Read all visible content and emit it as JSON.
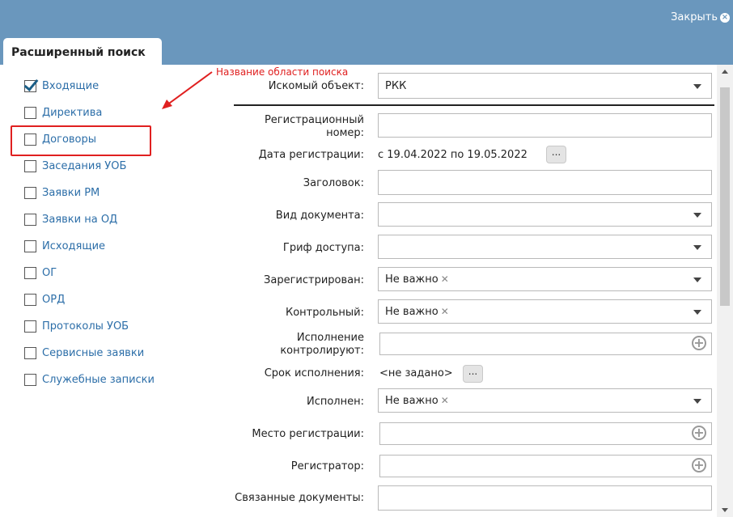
{
  "header": {
    "close_label": "Закрыть"
  },
  "tab": {
    "title": "Расширенный поиск"
  },
  "annotation": {
    "text": "Название области поиска"
  },
  "sidebar": {
    "items": [
      {
        "label": "Входящие"
      },
      {
        "label": "Директива"
      },
      {
        "label": "Договоры"
      },
      {
        "label": "Заседания УОБ"
      },
      {
        "label": "Заявки РМ"
      },
      {
        "label": "Заявки на ОД"
      },
      {
        "label": "Исходящие"
      },
      {
        "label": "ОГ"
      },
      {
        "label": "ОРД"
      },
      {
        "label": "Протоколы УОБ"
      },
      {
        "label": "Сервисные заявки"
      },
      {
        "label": "Служебные записки"
      }
    ],
    "checked": [
      "Входящие"
    ]
  },
  "form": {
    "search_object": {
      "label": "Искомый объект:",
      "value": "РКК"
    },
    "reg_number": {
      "label_line1": "Регистрационный",
      "label_line2": "номер:",
      "value": ""
    },
    "reg_date": {
      "label": "Дата регистрации:",
      "value": "с 19.04.2022 по 19.05.2022",
      "button": "..."
    },
    "heading": {
      "label": "Заголовок:",
      "value": ""
    },
    "doc_type": {
      "label": "Вид документа:",
      "value": ""
    },
    "access": {
      "label": "Гриф доступа:",
      "value": ""
    },
    "registered": {
      "label": "Зарегистрирован:",
      "value": "Не важно",
      "clear": "✕"
    },
    "control": {
      "label": "Контрольный:",
      "value": "Не важно",
      "clear": "✕"
    },
    "controllers": {
      "label_line1": "Исполнение",
      "label_line2": "контролируют:",
      "value": ""
    },
    "deadline": {
      "label": "Срок исполнения:",
      "value": "<не задано>",
      "button": "..."
    },
    "executed": {
      "label": "Исполнен:",
      "value": "Не важно",
      "clear": "✕"
    },
    "reg_place": {
      "label": "Место регистрации:",
      "value": ""
    },
    "registrar": {
      "label": "Регистратор:",
      "value": ""
    },
    "related": {
      "label": "Связанные документы:",
      "value": ""
    }
  },
  "colors": {
    "header_bg": "#6a97bd",
    "link": "#2c6ea8",
    "annotation": "#e02020"
  }
}
